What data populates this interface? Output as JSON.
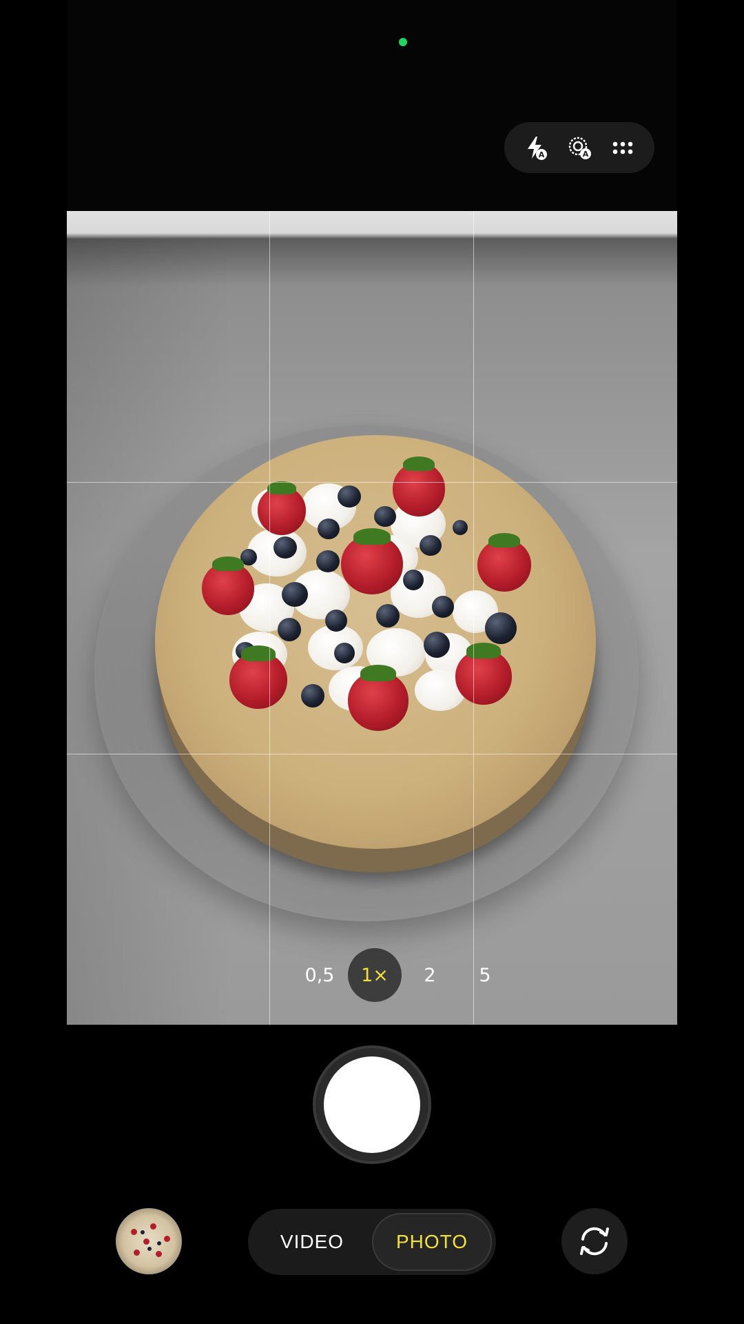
{
  "app": {
    "name": "Camera"
  },
  "status": {
    "indicator_color": "#1ed760"
  },
  "quick_controls": [
    {
      "name": "flash-auto-icon",
      "label": "Flash auto"
    },
    {
      "name": "motion-photo-auto-icon",
      "label": "Live auto"
    },
    {
      "name": "more-options-icon",
      "label": "More"
    }
  ],
  "viewfinder": {
    "grid": "3x3",
    "subject": "crepe cake with whipped cream, strawberries and blueberries"
  },
  "zoom": {
    "levels": [
      "0,5",
      "1×",
      "2",
      "5"
    ],
    "selected": "1×",
    "accent_color": "#f3e13a"
  },
  "shutter": {
    "label": "Take photo"
  },
  "modes": {
    "items": [
      "VIDEO",
      "PHOTO"
    ],
    "selected": "PHOTO"
  },
  "gallery": {
    "label": "Last photo thumbnail"
  },
  "flip": {
    "label": "Switch camera"
  }
}
